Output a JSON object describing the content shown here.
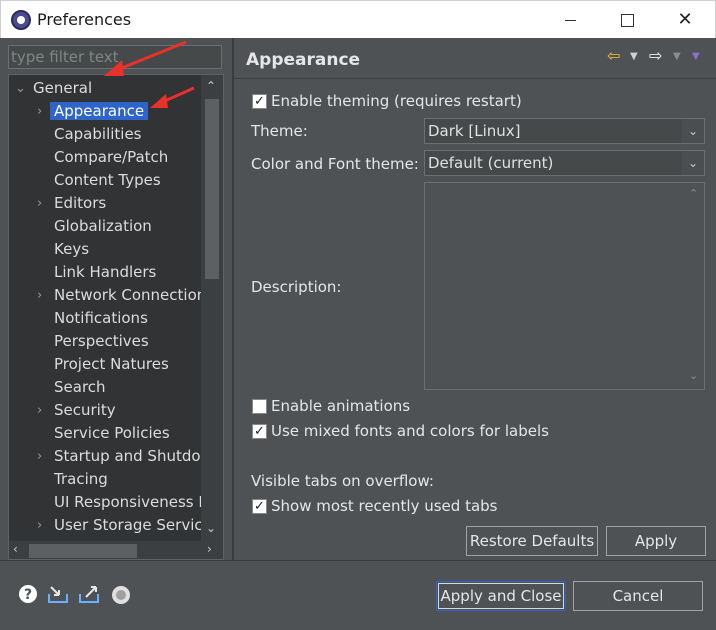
{
  "window": {
    "title": "Preferences",
    "minimize_glyph": "",
    "maximize_glyph": "",
    "close_glyph": "✕"
  },
  "filter": {
    "placeholder": "type filter text"
  },
  "tree": {
    "root_label": "General",
    "items": [
      {
        "label": "Appearance",
        "expandable": true,
        "selected": true
      },
      {
        "label": "Capabilities",
        "expandable": false
      },
      {
        "label": "Compare/Patch",
        "expandable": false
      },
      {
        "label": "Content Types",
        "expandable": false
      },
      {
        "label": "Editors",
        "expandable": true
      },
      {
        "label": "Globalization",
        "expandable": false
      },
      {
        "label": "Keys",
        "expandable": false
      },
      {
        "label": "Link Handlers",
        "expandable": false
      },
      {
        "label": "Network Connection",
        "expandable": true
      },
      {
        "label": "Notifications",
        "expandable": false
      },
      {
        "label": "Perspectives",
        "expandable": false
      },
      {
        "label": "Project Natures",
        "expandable": false
      },
      {
        "label": "Search",
        "expandable": false
      },
      {
        "label": "Security",
        "expandable": true
      },
      {
        "label": "Service Policies",
        "expandable": false
      },
      {
        "label": "Startup and Shutdown",
        "expandable": true
      },
      {
        "label": "Tracing",
        "expandable": false
      },
      {
        "label": "UI Responsiveness M",
        "expandable": false
      },
      {
        "label": "User Storage Service",
        "expandable": true
      }
    ]
  },
  "page": {
    "title": "Appearance",
    "enable_theming": {
      "label": "Enable theming (requires restart)",
      "checked": true
    },
    "theme": {
      "label": "Theme:",
      "value": "Dark [Linux]"
    },
    "color_font_theme": {
      "label": "Color and Font theme:",
      "value": "Default (current)"
    },
    "description_label": "Description:",
    "enable_animations": {
      "label": "Enable animations",
      "checked": false
    },
    "mixed_fonts": {
      "label": "Use mixed fonts and colors for labels",
      "checked": true
    },
    "visible_tabs_label": "Visible tabs on overflow:",
    "show_mru_tabs": {
      "label": "Show most recently used tabs",
      "checked": true
    }
  },
  "buttons": {
    "restore_defaults": "Restore Defaults",
    "apply": "Apply",
    "apply_and_close": "Apply and Close",
    "cancel": "Cancel"
  },
  "icons": {
    "back": "back-arrow-icon",
    "forward": "forward-arrow-icon",
    "help": "help-icon",
    "import": "import-icon",
    "export": "export-icon",
    "record": "record-icon"
  },
  "colors": {
    "selection": "#2f65ca",
    "annotation": "#e8312a",
    "background": "#4e5254"
  }
}
